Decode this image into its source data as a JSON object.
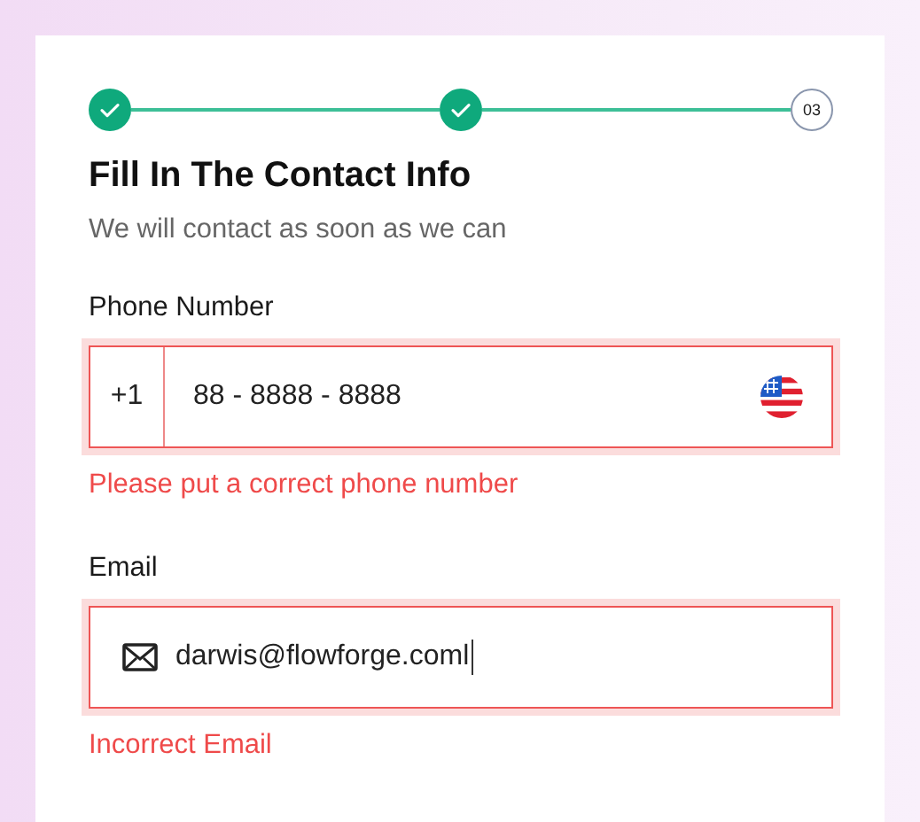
{
  "steps": [
    {
      "done": true
    },
    {
      "done": true
    },
    {
      "done": false,
      "label": "03"
    }
  ],
  "title": "Fill In The Contact Info",
  "subtitle": "We will contact as soon as we can",
  "fields": [
    {
      "kind": "phone",
      "label": "Phone Number",
      "prefix": "+1",
      "value": "88 - 8888 - 8888",
      "error": true,
      "message": "Please put a correct phone number"
    },
    {
      "kind": "email",
      "label": "Email",
      "value": "darwis@flowforge.coml",
      "error": true,
      "focused": true,
      "message": "Incorrect Email"
    }
  ]
}
